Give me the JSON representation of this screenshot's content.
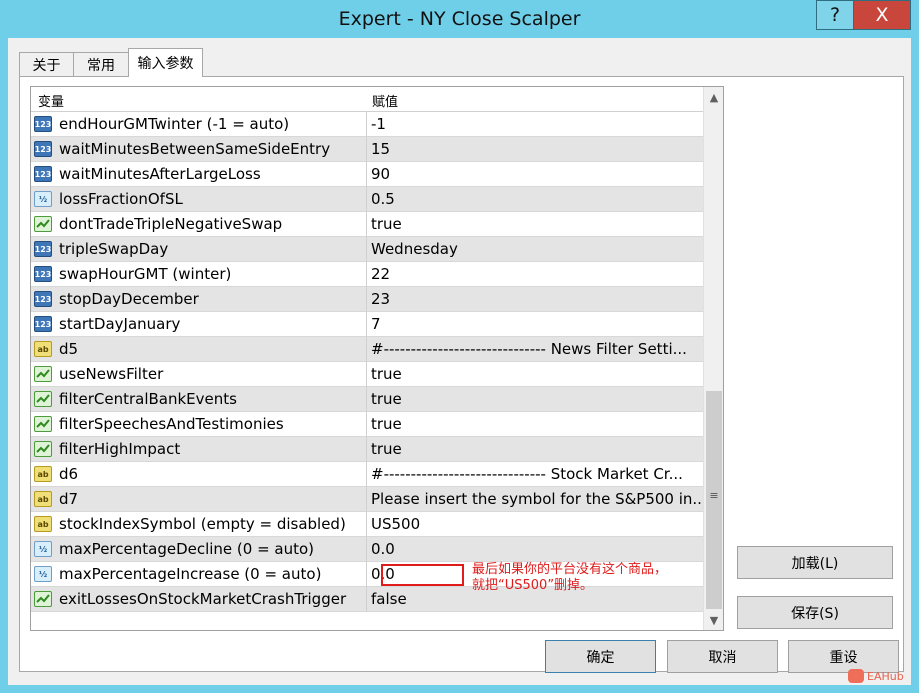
{
  "window": {
    "title": "Expert - NY Close Scalper",
    "help_label": "?",
    "close_label": "X"
  },
  "tabs": [
    {
      "label": "关于"
    },
    {
      "label": "常用"
    },
    {
      "label": "输入参数"
    }
  ],
  "grid": {
    "col_variable": "变量",
    "col_value": "赋值",
    "rows": [
      {
        "icon": "integer-icon",
        "icon_text": "123",
        "name": "endHourGMTwinter (-1 = auto)",
        "value": "-1"
      },
      {
        "icon": "integer-icon",
        "icon_text": "123",
        "name": "waitMinutesBetweenSameSideEntry",
        "value": "15"
      },
      {
        "icon": "integer-icon",
        "icon_text": "123",
        "name": "waitMinutesAfterLargeLoss",
        "value": "90"
      },
      {
        "icon": "double-icon",
        "icon_text": "½",
        "name": "lossFractionOfSL",
        "value": "0.5"
      },
      {
        "icon": "bool-icon",
        "icon_text": "",
        "name": "dontTradeTripleNegativeSwap",
        "value": "true"
      },
      {
        "icon": "integer-icon",
        "icon_text": "123",
        "name": "tripleSwapDay",
        "value": "Wednesday"
      },
      {
        "icon": "integer-icon",
        "icon_text": "123",
        "name": "swapHourGMT (winter)",
        "value": "22"
      },
      {
        "icon": "integer-icon",
        "icon_text": "123",
        "name": "stopDayDecember",
        "value": "23"
      },
      {
        "icon": "integer-icon",
        "icon_text": "123",
        "name": "startDayJanuary",
        "value": "7"
      },
      {
        "icon": "string-icon",
        "icon_text": "ab",
        "name": "d5",
        "value": "#------------------------------ News Filter Setti..."
      },
      {
        "icon": "bool-icon",
        "icon_text": "",
        "name": "useNewsFilter",
        "value": "true"
      },
      {
        "icon": "bool-icon",
        "icon_text": "",
        "name": "filterCentralBankEvents",
        "value": "true"
      },
      {
        "icon": "bool-icon",
        "icon_text": "",
        "name": "filterSpeechesAndTestimonies",
        "value": "true"
      },
      {
        "icon": "bool-icon",
        "icon_text": "",
        "name": "filterHighImpact",
        "value": "true"
      },
      {
        "icon": "string-icon",
        "icon_text": "ab",
        "name": "d6",
        "value": "#------------------------------ Stock Market Cr..."
      },
      {
        "icon": "string-icon",
        "icon_text": "ab",
        "name": "d7",
        "value": "Please insert the symbol for the S&P500 in..."
      },
      {
        "icon": "string-icon",
        "icon_text": "ab",
        "name": "stockIndexSymbol (empty = disabled)",
        "value": "US500"
      },
      {
        "icon": "double-icon",
        "icon_text": "½",
        "name": "maxPercentageDecline (0 = auto)",
        "value": "0.0"
      },
      {
        "icon": "double-icon",
        "icon_text": "½",
        "name": "maxPercentageIncrease (0 = auto)",
        "value": "0.0"
      },
      {
        "icon": "bool-icon",
        "icon_text": "",
        "name": "exitLossesOnStockMarketCrashTrigger",
        "value": "false"
      }
    ]
  },
  "annotation": {
    "line1": "最后如果你的平台没有这个商品，",
    "line2": "就把“US500”删掉。"
  },
  "buttons": {
    "load": "加载(L)",
    "save": "保存(S)",
    "ok": "确定",
    "cancel": "取消",
    "reset": "重设"
  },
  "watermark": "EAHub",
  "colors": {
    "titlebar": "#6fcfe9",
    "close_button": "#c9463c",
    "annotation": "#e01b1b"
  }
}
